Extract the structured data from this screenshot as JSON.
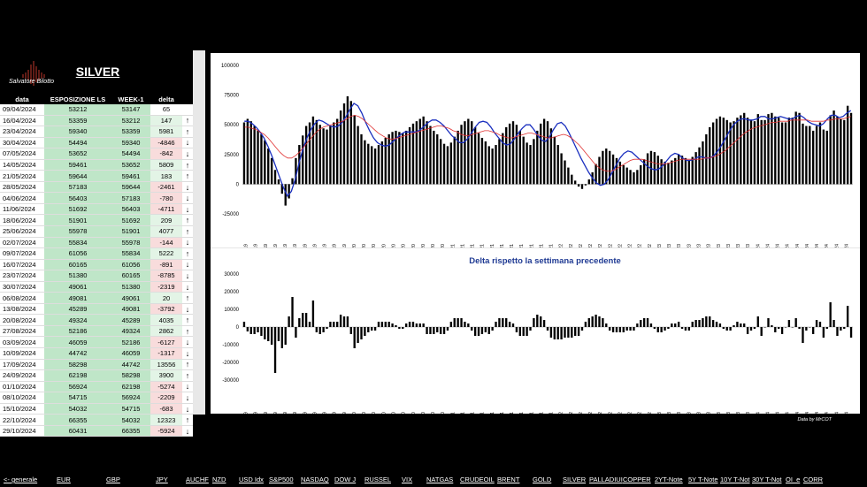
{
  "logo": {
    "text": "Salvatore Bilotto"
  },
  "asset_title": "SILVER",
  "table": {
    "headers": [
      "data",
      "ESPOSIZIONE LS",
      "WEEK-1",
      "delta"
    ],
    "rows": [
      {
        "date": "09/04/2024",
        "exp": "53212",
        "prev": "53147",
        "delta": "65",
        "dir": "none"
      },
      {
        "date": "16/04/2024",
        "exp": "53359",
        "prev": "53212",
        "delta": "147",
        "dir": "up"
      },
      {
        "date": "23/04/2024",
        "exp": "59340",
        "prev": "53359",
        "delta": "5981",
        "dir": "up"
      },
      {
        "date": "30/04/2024",
        "exp": "54494",
        "prev": "59340",
        "delta": "-4846",
        "dir": "down"
      },
      {
        "date": "07/05/2024",
        "exp": "53652",
        "prev": "54494",
        "delta": "-842",
        "dir": "down"
      },
      {
        "date": "14/05/2024",
        "exp": "59461",
        "prev": "53652",
        "delta": "5809",
        "dir": "up"
      },
      {
        "date": "21/05/2024",
        "exp": "59644",
        "prev": "59461",
        "delta": "183",
        "dir": "up"
      },
      {
        "date": "28/05/2024",
        "exp": "57183",
        "prev": "59644",
        "delta": "-2461",
        "dir": "down"
      },
      {
        "date": "04/06/2024",
        "exp": "56403",
        "prev": "57183",
        "delta": "-780",
        "dir": "down"
      },
      {
        "date": "11/06/2024",
        "exp": "51692",
        "prev": "56403",
        "delta": "-4711",
        "dir": "down"
      },
      {
        "date": "18/06/2024",
        "exp": "51901",
        "prev": "51692",
        "delta": "209",
        "dir": "up"
      },
      {
        "date": "25/06/2024",
        "exp": "55978",
        "prev": "51901",
        "delta": "4077",
        "dir": "up"
      },
      {
        "date": "02/07/2024",
        "exp": "55834",
        "prev": "55978",
        "delta": "-144",
        "dir": "down"
      },
      {
        "date": "09/07/2024",
        "exp": "61056",
        "prev": "55834",
        "delta": "5222",
        "dir": "up"
      },
      {
        "date": "16/07/2024",
        "exp": "60165",
        "prev": "61056",
        "delta": "-891",
        "dir": "down"
      },
      {
        "date": "23/07/2024",
        "exp": "51380",
        "prev": "60165",
        "delta": "-8785",
        "dir": "down"
      },
      {
        "date": "30/07/2024",
        "exp": "49061",
        "prev": "51380",
        "delta": "-2319",
        "dir": "down"
      },
      {
        "date": "06/08/2024",
        "exp": "49081",
        "prev": "49061",
        "delta": "20",
        "dir": "up"
      },
      {
        "date": "13/08/2024",
        "exp": "45289",
        "prev": "49081",
        "delta": "-3792",
        "dir": "down"
      },
      {
        "date": "20/08/2024",
        "exp": "49324",
        "prev": "45289",
        "delta": "4035",
        "dir": "up"
      },
      {
        "date": "27/08/2024",
        "exp": "52186",
        "prev": "49324",
        "delta": "2862",
        "dir": "up"
      },
      {
        "date": "03/09/2024",
        "exp": "46059",
        "prev": "52186",
        "delta": "-6127",
        "dir": "down"
      },
      {
        "date": "10/09/2024",
        "exp": "44742",
        "prev": "46059",
        "delta": "-1317",
        "dir": "down"
      },
      {
        "date": "17/09/2024",
        "exp": "58298",
        "prev": "44742",
        "delta": "13556",
        "dir": "up"
      },
      {
        "date": "24/09/2024",
        "exp": "62198",
        "prev": "58298",
        "delta": "3900",
        "dir": "up"
      },
      {
        "date": "01/10/2024",
        "exp": "56924",
        "prev": "62198",
        "delta": "-5274",
        "dir": "down"
      },
      {
        "date": "08/10/2024",
        "exp": "54715",
        "prev": "56924",
        "delta": "-2209",
        "dir": "down"
      },
      {
        "date": "15/10/2024",
        "exp": "54032",
        "prev": "54715",
        "delta": "-683",
        "dir": "down"
      },
      {
        "date": "22/10/2024",
        "exp": "66355",
        "prev": "54032",
        "delta": "12323",
        "dir": "up"
      },
      {
        "date": "29/10/2024",
        "exp": "60431",
        "prev": "66355",
        "delta": "-5924",
        "dir": "down"
      }
    ]
  },
  "colors": {
    "up": "#22a822",
    "down": "#d02020",
    "pos_bg": "#e3f4e6",
    "neg_bg": "#f8dcdc",
    "ma_fast": "#1a2fbf",
    "ma_slow": "#e03030",
    "bars": "#000000"
  },
  "chart_data": [
    {
      "type": "bar",
      "title": "",
      "ylim": [
        -25000,
        100000
      ],
      "yticks": [
        "100000",
        "75000",
        "50000",
        "25000",
        "0",
        "-25000"
      ],
      "x_start": "8/1/19",
      "x_end": "29/10/24",
      "xtick_labels": [
        "8/1/19",
        "5/2/19",
        "19/3/19",
        "23/4/19",
        "28/5/19",
        "2/7/19",
        "6/8/19",
        "10/9/19",
        "15/10/19",
        "19/11/19",
        "24/12/19",
        "28/1/20",
        "3/3/20",
        "7/4/20",
        "12/5/20",
        "16/6/20",
        "21/7/20",
        "25/8/20",
        "29/9/20",
        "3/11/20",
        "8/12/20",
        "12/1/21",
        "16/2/21",
        "23/3/21",
        "27/4/21",
        "1/6/21",
        "6/7/21",
        "10/8/21",
        "14/9/21",
        "19/10/21",
        "23/11/21",
        "28/12/21",
        "1/2/22",
        "8/3/22",
        "12/4/22",
        "17/5/22",
        "21/6/22",
        "26/7/22",
        "30/8/22",
        "4/10/22",
        "8/11/22",
        "13/12/22",
        "17/1/23",
        "21/2/23",
        "28/3/23",
        "2/5/23",
        "6/6/23",
        "11/7/23",
        "15/8/23",
        "19/9/23",
        "24/10/23",
        "28/11/23",
        "2/1/24",
        "6/2/24",
        "12/3/24",
        "16/4/24",
        "21/5/24",
        "25/6/24",
        "30/7/24",
        "3/9/24",
        "8/10/24",
        "29/10/24"
      ],
      "series": [
        {
          "name": "",
          "kind": "bar",
          "values": [
            52000,
            55000,
            53000,
            49000,
            45000,
            42000,
            37000,
            30000,
            22000,
            12000,
            4000,
            -8000,
            -18000,
            -12000,
            5000,
            22000,
            33000,
            41000,
            49000,
            52000,
            57000,
            54000,
            50000,
            47000,
            46000,
            49000,
            52000,
            55000,
            62000,
            68000,
            74000,
            70000,
            58000,
            49000,
            42000,
            37000,
            34000,
            32000,
            30000,
            33000,
            36000,
            39000,
            42000,
            44000,
            45000,
            44000,
            43000,
            45000,
            48000,
            51000,
            53000,
            55000,
            57000,
            53000,
            49000,
            45000,
            42000,
            38000,
            34000,
            32000,
            35000,
            40000,
            45000,
            50000,
            53000,
            55000,
            53000,
            48000,
            43000,
            39000,
            36000,
            32000,
            30000,
            33000,
            38000,
            43000,
            48000,
            51000,
            53000,
            50000,
            45000,
            40000,
            35000,
            33000,
            38000,
            45000,
            51000,
            55000,
            53000,
            47000,
            40000,
            33000,
            26000,
            20000,
            14000,
            8000,
            3000,
            -2000,
            -4000,
            -1000,
            4000,
            10000,
            17000,
            23000,
            28000,
            30000,
            28000,
            25000,
            22000,
            19000,
            16000,
            14000,
            12000,
            10000,
            12000,
            16000,
            21000,
            26000,
            28000,
            27000,
            24000,
            21000,
            19000,
            18000,
            20000,
            22000,
            25000,
            24000,
            22000,
            20000,
            23000,
            27000,
            31000,
            36000,
            42000,
            48000,
            52000,
            55000,
            57000,
            56000,
            54000,
            52000,
            53000,
            56000,
            58000,
            60000,
            56000,
            54000,
            53000,
            59000,
            54000,
            54000,
            59000,
            60000,
            57000,
            56000,
            52000,
            52000,
            56000,
            56000,
            61000,
            60000,
            51000,
            49000,
            49000,
            45000,
            49000,
            52000,
            46000,
            45000,
            58000,
            62000,
            57000,
            55000,
            54000,
            66000,
            60000
          ]
        },
        {
          "name": "",
          "kind": "line",
          "color": "#1a2fbf",
          "values": [
            53000,
            53000,
            51000,
            48000,
            44000,
            39000,
            32000,
            24000,
            15000,
            6000,
            -3000,
            -10000,
            -6000,
            4000,
            18000,
            30000,
            39000,
            46000,
            51000,
            54000,
            53000,
            51000,
            49000,
            48000,
            49000,
            52000,
            57000,
            63000,
            68000,
            66000,
            60000,
            52000,
            45000,
            39000,
            35000,
            33000,
            32000,
            33000,
            36000,
            39000,
            42000,
            44000,
            44000,
            44000,
            44000,
            46000,
            49000,
            52000,
            54000,
            54000,
            52000,
            49000,
            45000,
            41000,
            38000,
            35000,
            35000,
            38000,
            43000,
            48000,
            52000,
            53000,
            52000,
            48000,
            43000,
            39000,
            35000,
            33000,
            34000,
            38000,
            43000,
            47000,
            50000,
            50000,
            46000,
            41000,
            37000,
            36000,
            40000,
            46000,
            51000,
            52000,
            49000,
            43000,
            36000,
            29000,
            22000,
            16000,
            10000,
            5000,
            1000,
            -1000,
            0,
            4000,
            10000,
            16000,
            22000,
            26000,
            28000,
            27000,
            24000,
            21000,
            18000,
            15000,
            13000,
            12000,
            13000,
            16000,
            20000,
            24000,
            26000,
            25000,
            22000,
            20000,
            20000,
            21000,
            23000,
            23000,
            22000,
            22000,
            24000,
            28000,
            33000,
            39000,
            45000,
            50000,
            53000,
            55000,
            55000,
            54000,
            54000,
            55000,
            57000,
            57000,
            55000,
            55000,
            56000,
            57000,
            56000,
            55000,
            55000,
            57000,
            58000,
            56000,
            53000,
            51000,
            50000,
            49000,
            51000,
            55000,
            58000,
            58000,
            56000,
            57000,
            60000,
            62000
          ]
        },
        {
          "name": "",
          "kind": "line",
          "color": "#e03030",
          "values": [
            48000,
            48000,
            47000,
            46000,
            44000,
            42000,
            39000,
            35000,
            31000,
            27000,
            24000,
            22000,
            22000,
            24000,
            27000,
            31000,
            35000,
            39000,
            43000,
            46000,
            48000,
            49000,
            50000,
            51000,
            52000,
            53000,
            55000,
            57000,
            58000,
            57000,
            55000,
            52000,
            49000,
            46000,
            43000,
            41000,
            39000,
            38000,
            38000,
            39000,
            40000,
            41000,
            42000,
            43000,
            44000,
            45000,
            46000,
            47000,
            48000,
            49000,
            49000,
            48000,
            47000,
            45000,
            44000,
            42000,
            41000,
            41000,
            42000,
            43000,
            44000,
            45000,
            45000,
            44000,
            43000,
            41000,
            40000,
            39000,
            39000,
            40000,
            41000,
            42000,
            43000,
            43000,
            42000,
            41000,
            40000,
            39000,
            39000,
            40000,
            41000,
            42000,
            41000,
            39000,
            36000,
            33000,
            29000,
            25000,
            21000,
            17000,
            14000,
            12000,
            11000,
            11000,
            12000,
            14000,
            16000,
            18000,
            20000,
            21000,
            21000,
            21000,
            20000,
            19000,
            18000,
            17000,
            17000,
            17000,
            18000,
            19000,
            20000,
            21000,
            21000,
            21000,
            21000,
            21000,
            21000,
            22000,
            22000,
            23000,
            24000,
            26000,
            28000,
            31000,
            34000,
            37000,
            40000,
            43000,
            45000,
            47000,
            48000,
            49000,
            50000,
            51000,
            52000,
            52000,
            53000,
            53000,
            53000,
            54000,
            54000,
            54000,
            54000,
            54000,
            53000,
            53000,
            53000,
            53000,
            54000,
            54000,
            55000,
            55000,
            55000,
            56000,
            57000
          ]
        }
      ]
    },
    {
      "type": "bar",
      "title": "Delta rispetto la settimana precedente",
      "ylim": [
        -30000,
        30000
      ],
      "yticks": [
        "30000",
        "20000",
        "10000",
        "0",
        "-10000",
        "-20000",
        "-30000"
      ],
      "series": [
        {
          "name": "",
          "kind": "bar",
          "values": [
            3000,
            -2500,
            -4000,
            -4000,
            -3000,
            -5000,
            -7000,
            -8000,
            -10000,
            -26000,
            -8000,
            -12000,
            -10000,
            6000,
            17000,
            -6000,
            5000,
            8000,
            8000,
            3000,
            15000,
            -3000,
            -4000,
            -3000,
            -1000,
            3000,
            3000,
            3000,
            7000,
            6000,
            6000,
            -4000,
            -12000,
            -9000,
            -7000,
            -5000,
            -3000,
            -2000,
            -2000,
            3000,
            3000,
            3000,
            3000,
            2000,
            1000,
            -1000,
            -1000,
            2000,
            3000,
            3000,
            2000,
            2000,
            2000,
            -4000,
            -4000,
            -4000,
            -3000,
            -4000,
            -4000,
            -2000,
            3000,
            5000,
            5000,
            5000,
            3000,
            2000,
            -2000,
            -5000,
            -5000,
            -4000,
            -3000,
            -4000,
            -2000,
            3000,
            5000,
            5000,
            5000,
            3000,
            2000,
            -3000,
            -5000,
            -5000,
            -5000,
            -2000,
            5000,
            7000,
            6000,
            4000,
            -2000,
            -6000,
            -7000,
            -7000,
            -7000,
            -6000,
            -6000,
            -6000,
            -5000,
            -5000,
            -2000,
            3000,
            5000,
            6000,
            7000,
            6000,
            5000,
            2000,
            -2000,
            -3000,
            -3000,
            -3000,
            -3000,
            -2000,
            -2000,
            -2000,
            2000,
            4000,
            5000,
            5000,
            2000,
            -1000,
            -3000,
            -3000,
            -2000,
            -1000,
            2000,
            2000,
            3000,
            -1000,
            -2000,
            -2000,
            3000,
            4000,
            4000,
            5000,
            6000,
            6000,
            4000,
            3000,
            2000,
            -1000,
            -2000,
            -2000,
            1000,
            3000,
            2000,
            2000,
            -4000,
            -2000,
            -1000,
            6000,
            -5000,
            0,
            5000,
            1000,
            -3000,
            -1000,
            -4000,
            0,
            4000,
            0,
            5000,
            -1000,
            -9000,
            -2000,
            0,
            -4000,
            4000,
            3000,
            -6000,
            -1000,
            14000,
            4000,
            -5000,
            -2000,
            -1000,
            12000,
            -6000
          ]
        }
      ]
    }
  ],
  "credit": "Data by MrCOT",
  "nav": [
    "<- generale",
    "EUR",
    "GBP",
    "JPY",
    "AUCHF",
    "NZD",
    "USD Idx",
    "S&P500",
    "NASDAQ",
    "DOW J",
    "RUSSEL",
    "VIX",
    "NATGAS",
    "CRUDEOIL",
    "BRENT",
    "GOLD",
    "SILVER",
    "PALLADIUI",
    "COPPER",
    "2YT-Note",
    "5Y T-Note",
    "10Y T-Not",
    "30Y T-Not",
    "OI_e",
    "CORR"
  ]
}
